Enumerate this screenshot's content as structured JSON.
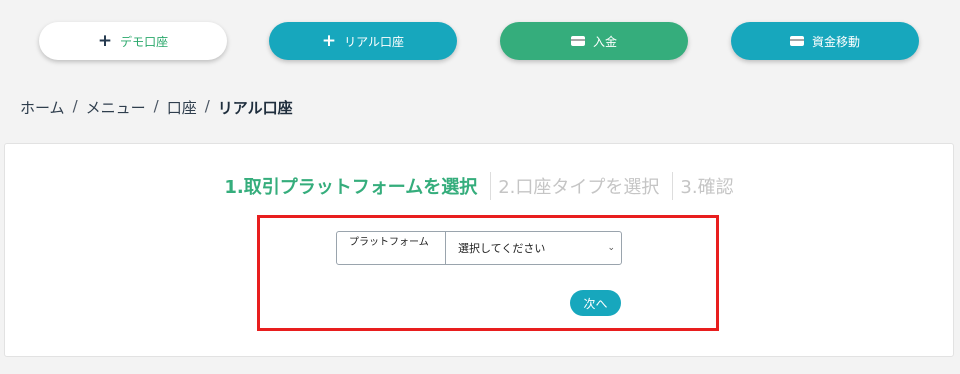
{
  "actions": {
    "demo_account": "デモ口座",
    "real_account": "リアル口座",
    "deposit": "入金",
    "transfer": "資金移動"
  },
  "breadcrumb": {
    "home": "ホーム",
    "menu": "メニュー",
    "account": "口座",
    "current": "リアル口座",
    "separator": "/"
  },
  "steps": {
    "step1": "1.取引プラットフォームを選択",
    "step2": "2.口座タイプを選択",
    "step3": "3.確認"
  },
  "form": {
    "platform_label": "プラットフォーム",
    "platform_selected": "選択してください",
    "next_label": "次へ"
  },
  "colors": {
    "accent_teal": "#17a7bd",
    "accent_green": "#35ad7c",
    "highlight_red": "#e81e1e"
  },
  "icons": {
    "plus": "plus-icon",
    "card": "card-icon",
    "chevron": "chevron-down-icon"
  }
}
